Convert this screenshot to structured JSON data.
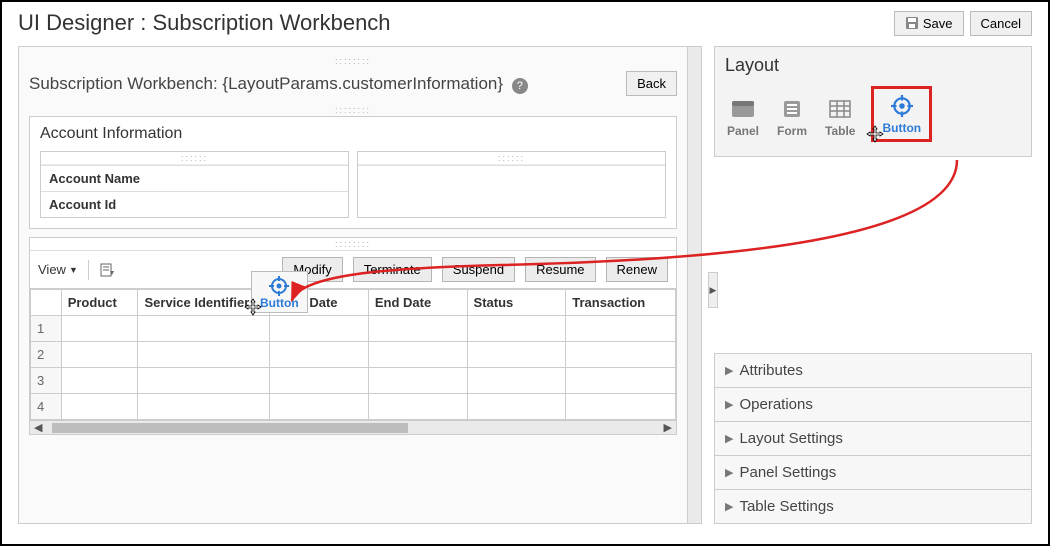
{
  "header": {
    "title": "UI Designer : Subscription Workbench",
    "save": "Save",
    "cancel": "Cancel"
  },
  "canvas": {
    "title_prefix": "Subscription Workbench: ",
    "title_expr": "{LayoutParams.customerInformation}",
    "back": "Back",
    "account_section": {
      "title": "Account Information",
      "fields": [
        "Account Name",
        "Account Id"
      ]
    },
    "table": {
      "view_label": "View",
      "actions": [
        "Modify",
        "Terminate",
        "Suspend",
        "Resume",
        "Renew"
      ],
      "columns": [
        "",
        "Product",
        "Service Identifier",
        "Start Date",
        "End Date",
        "Status",
        "Transaction"
      ],
      "rows": [
        1,
        2,
        3,
        4
      ]
    },
    "drag_ghost_label": "Button"
  },
  "layout_panel": {
    "title": "Layout",
    "palette": [
      {
        "name": "panel",
        "label": "Panel"
      },
      {
        "name": "form",
        "label": "Form"
      },
      {
        "name": "table",
        "label": "Table"
      },
      {
        "name": "button",
        "label": "Button"
      }
    ]
  },
  "accordion": [
    "Attributes",
    "Operations",
    "Layout Settings",
    "Panel Settings",
    "Table Settings"
  ]
}
